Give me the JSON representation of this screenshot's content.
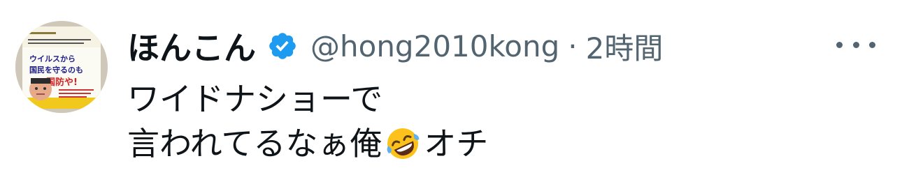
{
  "user": {
    "display_name": "ほんこん",
    "handle": "@hong2010kong",
    "separator": "·",
    "time": "2時間"
  },
  "icons": {
    "verified": "verified-badge-icon",
    "more": "more-options-icon",
    "emoji": "rolling-on-the-floor-laughing-emoji",
    "verified_color": "#1d9bf0"
  },
  "tweet": {
    "line1": "ワイドナショーで",
    "line2_before_emoji": "言われてるなぁ俺",
    "line2_after_emoji": "オチ"
  },
  "avatar": {
    "book_title_line1": "ウイルスから",
    "book_title_line2": "国民を守るのも",
    "book_title_line3": "国防や!"
  }
}
